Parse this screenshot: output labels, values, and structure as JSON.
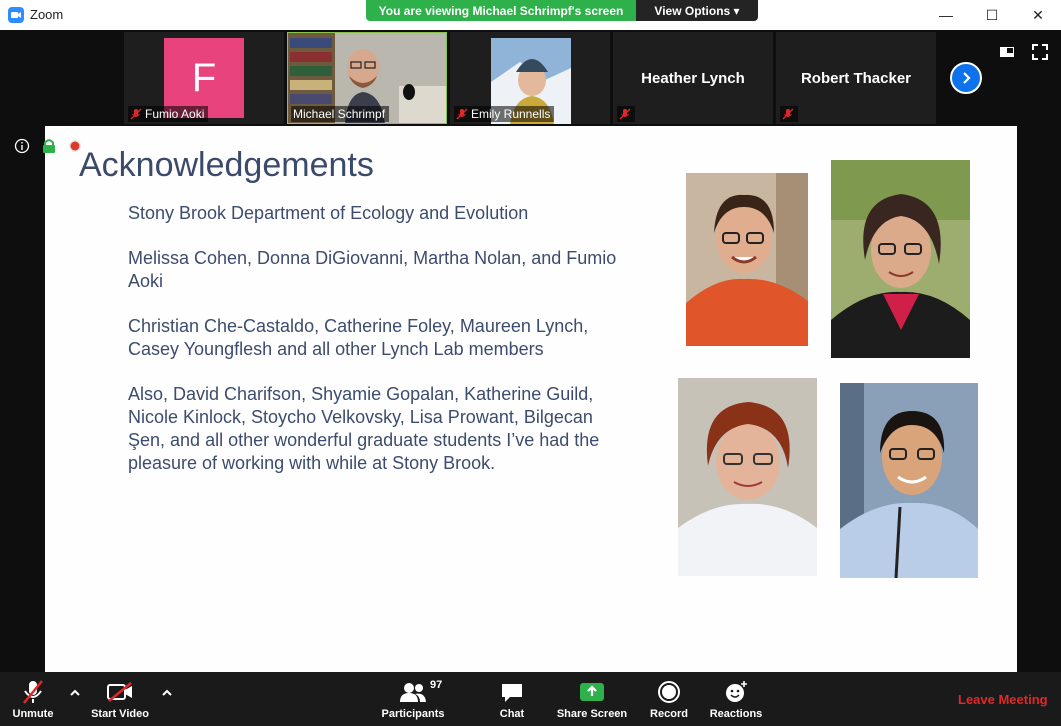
{
  "window": {
    "title": "Zoom",
    "minimize": "—",
    "maximize": "☐",
    "close": "✕"
  },
  "share_banner": {
    "viewing_text": "You are viewing Michael Schrimpf's screen",
    "view_options_label": "View Options ▾"
  },
  "participants_strip": [
    {
      "name": "Fumio Aoki",
      "avatar_letter": "F",
      "muted": true
    },
    {
      "name": "Michael Schrimpf",
      "muted": false,
      "active_speaker": true
    },
    {
      "name": "Emily Runnells",
      "muted": true
    },
    {
      "name": "Heather Lynch",
      "muted": true
    },
    {
      "name": "Robert Thacker",
      "muted": true
    }
  ],
  "slide": {
    "title": "Acknowledgements",
    "paragraphs": [
      "Stony Brook Department of Ecology and Evolution",
      "Melissa Cohen, Donna DiGiovanni, Martha Nolan, and Fumio Aoki",
      "Christian Che-Castaldo, Catherine Foley, Maureen Lynch, Casey Youngflesh and all other Lynch Lab members",
      "Also, David Charifson, Shyamie Gopalan, Katherine Guild, Nicole Kinlock, Stoycho Velkovsky, Lisa Prowant, Bilgecan Şen, and all other wonderful graduate students I’ve had the pleasure of working with while at Stony Brook."
    ]
  },
  "toolbar": {
    "unmute": "Unmute",
    "start_video": "Start Video",
    "participants": "Participants",
    "participants_count": "97",
    "chat": "Chat",
    "share_screen": "Share Screen",
    "record": "Record",
    "reactions": "Reactions",
    "leave": "Leave Meeting"
  },
  "colors": {
    "share_green": "#2eb04a",
    "leave_red": "#e02828",
    "zoom_blue": "#0e72ed",
    "avatar_pink": "#e8437c",
    "slide_text": "#3d4c6e"
  }
}
